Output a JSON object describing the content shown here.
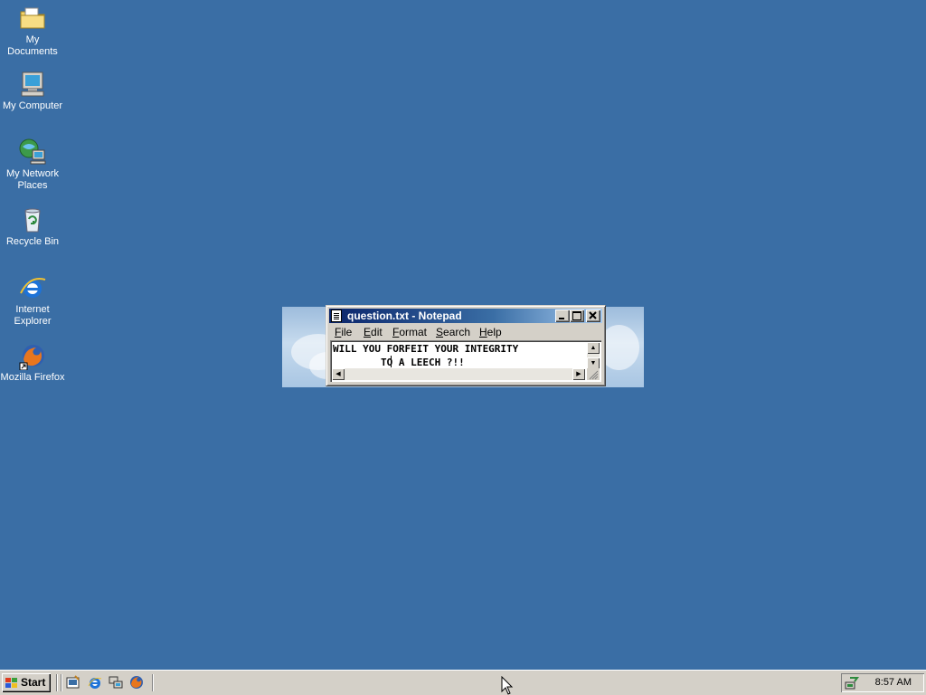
{
  "desktop": {
    "icons": [
      {
        "label": "My Documents",
        "icon": "folder-documents-icon"
      },
      {
        "label": "My Computer",
        "icon": "computer-icon"
      },
      {
        "label": "My Network Places",
        "icon": "network-icon"
      },
      {
        "label": "Recycle Bin",
        "icon": "recycle-bin-icon"
      },
      {
        "label": "Internet Explorer",
        "icon": "internet-explorer-icon"
      },
      {
        "label": "Mozilla Firefox",
        "icon": "firefox-icon"
      }
    ],
    "background_color": "#3a6ea5"
  },
  "notepad": {
    "title": "question.txt - Notepad",
    "menu": [
      {
        "label": "File",
        "accel": "F",
        "rest": "ile"
      },
      {
        "label": "Edit",
        "accel": "E",
        "rest": "dit"
      },
      {
        "label": "Format",
        "accel": "F",
        "rest": "ormat"
      },
      {
        "label": "Search",
        "accel": "S",
        "rest": "earch"
      },
      {
        "label": "Help",
        "accel": "H",
        "rest": "elp"
      }
    ],
    "content_lines": [
      "WILL YOU FORFEIT YOUR INTEGRITY",
      "        TO A LEECH ?!!"
    ]
  },
  "taskbar": {
    "start_label": "Start",
    "quick_launch": [
      "show-desktop-icon",
      "internet-explorer-icon",
      "network-icon",
      "firefox-icon"
    ],
    "clock": "8:57 AM"
  }
}
